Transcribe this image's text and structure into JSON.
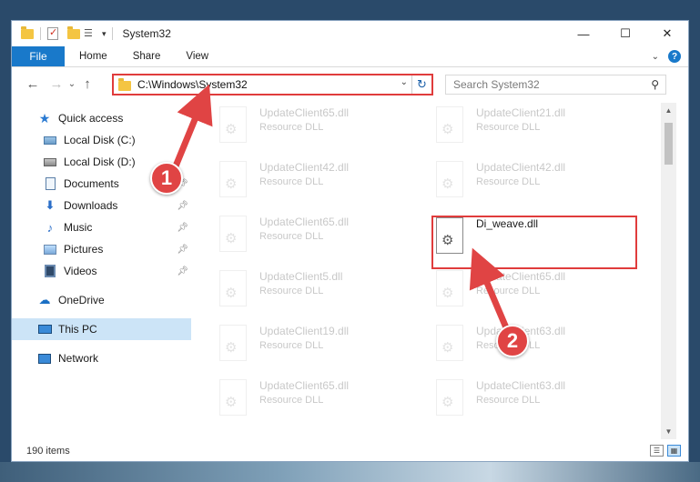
{
  "window": {
    "title": "System32",
    "controls": {
      "minimize": "—",
      "maximize": "☐",
      "close": "✕"
    }
  },
  "ribbon": {
    "file": "File",
    "tabs": [
      "Home",
      "Share",
      "View"
    ]
  },
  "navigation": {
    "back": "←",
    "forward": "→",
    "dropdown": "⌄",
    "up": "↑",
    "address": "C:\\Windows\\System32",
    "refresh": "↻",
    "search_placeholder": "Search System32"
  },
  "sidebar": {
    "items": [
      {
        "label": "Quick access",
        "icon": "star-icon"
      },
      {
        "label": "Local Disk (C:)",
        "icon": "disk-icon"
      },
      {
        "label": "Local Disk (D:)",
        "icon": "disk-icon"
      },
      {
        "label": "Documents",
        "icon": "documents-icon",
        "pinned": true
      },
      {
        "label": "Downloads",
        "icon": "downloads-icon",
        "pinned": true
      },
      {
        "label": "Music",
        "icon": "music-icon",
        "pinned": true
      },
      {
        "label": "Pictures",
        "icon": "pictures-icon",
        "pinned": true
      },
      {
        "label": "Videos",
        "icon": "videos-icon",
        "pinned": true
      },
      {
        "label": "OneDrive",
        "icon": "onedrive-icon"
      },
      {
        "label": "This PC",
        "icon": "this-pc-icon",
        "selected": true
      },
      {
        "label": "Network",
        "icon": "network-icon"
      }
    ]
  },
  "files": [
    {
      "name": "UpdateClient65.dll",
      "type": "Resource DLL",
      "faded": true
    },
    {
      "name": "UpdateClient21.dll",
      "type": "Resource DLL",
      "faded": true
    },
    {
      "name": "UpdateClient42.dll",
      "type": "Resource DLL",
      "faded": true
    },
    {
      "name": "UpdateClient42.dll",
      "type": "Resource DLL",
      "faded": true
    },
    {
      "name": "UpdateClient65.dll",
      "type": "Resource DLL",
      "faded": true
    },
    {
      "name": "Di_weave.dll",
      "type": "",
      "faded": false
    },
    {
      "name": "UpdateClient5.dll",
      "type": "Resource DLL",
      "faded": true
    },
    {
      "name": "UpdateClient65.dll",
      "type": "Resource DLL",
      "faded": true
    },
    {
      "name": "UpdateClient19.dll",
      "type": "Resource DLL",
      "faded": true
    },
    {
      "name": "UpdateClient63.dll",
      "type": "Resource DLL",
      "faded": true
    },
    {
      "name": "UpdateClient65.dll",
      "type": "Resource DLL",
      "faded": true
    },
    {
      "name": "UpdateClient63.dll",
      "type": "Resource DLL",
      "faded": true
    }
  ],
  "status": {
    "item_count": "190 items"
  },
  "annotations": {
    "badge1": "1",
    "badge2": "2",
    "color": "#e04444"
  }
}
